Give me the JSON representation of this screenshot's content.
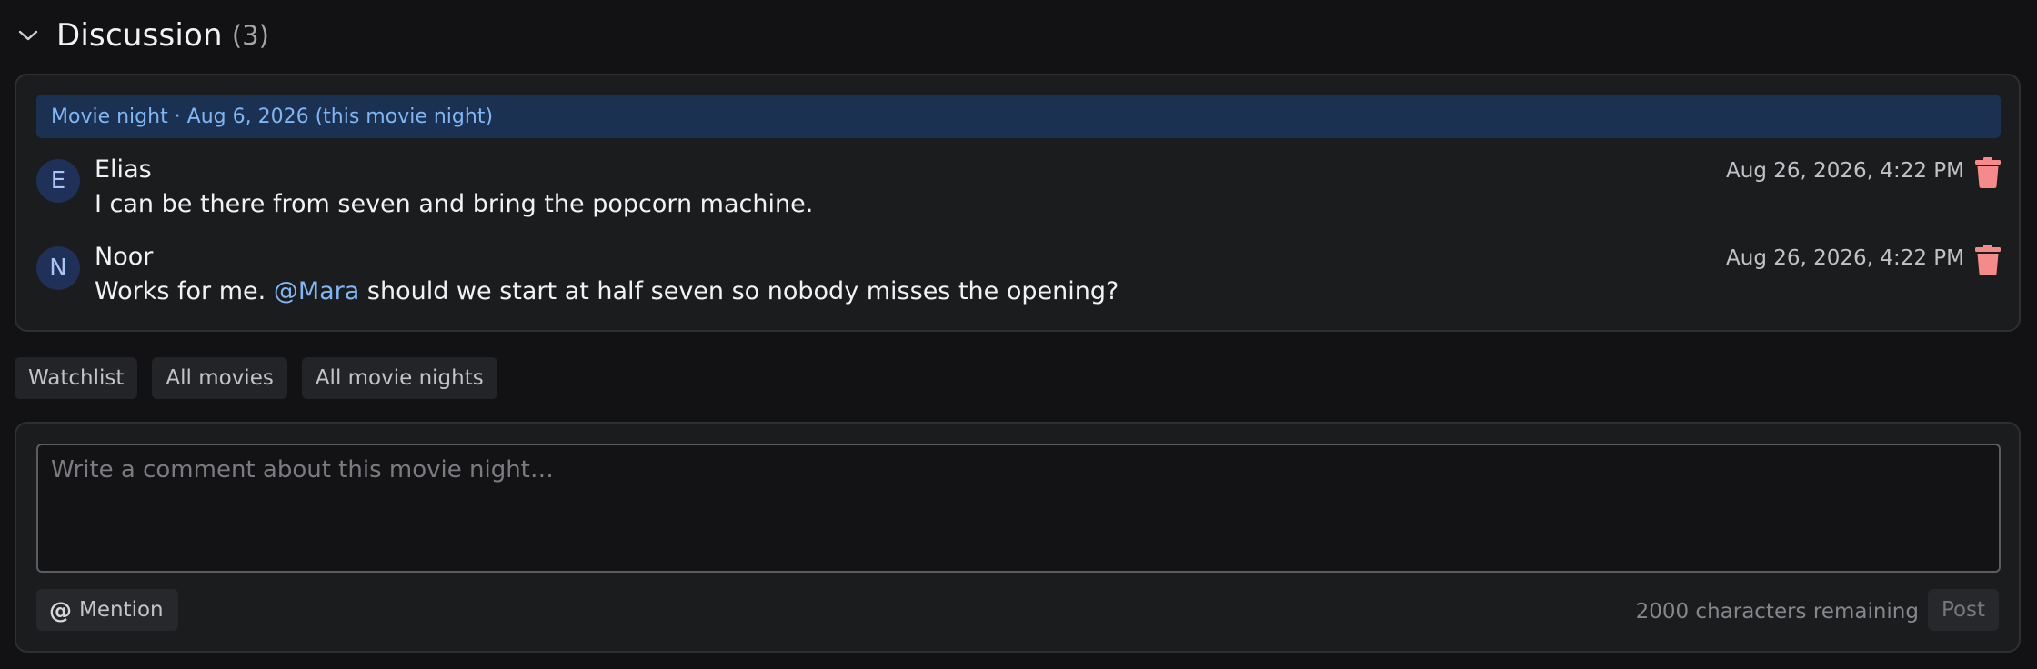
{
  "section": {
    "title": "Discussion",
    "count": "(3)"
  },
  "thread": {
    "banner": "Movie night · Aug 6, 2026 (this movie night)",
    "comments": [
      {
        "initial": "E",
        "author": "Elias",
        "text": "I can be there from seven and bring the popcorn machine.",
        "timestamp": "Aug 26, 2026, 4:22 PM"
      },
      {
        "initial": "N",
        "author": "Noor",
        "text_before": "Works for me. ",
        "mention": "@Mara",
        "text_after": " should we start at half seven so nobody misses the opening?",
        "timestamp": "Aug 26, 2026, 4:22 PM"
      }
    ]
  },
  "links": [
    "Watchlist",
    "All movies",
    "All movie nights"
  ],
  "composer": {
    "placeholder": "Write a comment about this movie night…",
    "mention_label": "Mention",
    "remaining": "2000 characters remaining",
    "post_label": "Post"
  },
  "colors": {
    "accent": "#7fb6f3",
    "banner_bg": "#1b3152",
    "delete": "#f48a8a",
    "avatar_bg": "#1f3158"
  }
}
